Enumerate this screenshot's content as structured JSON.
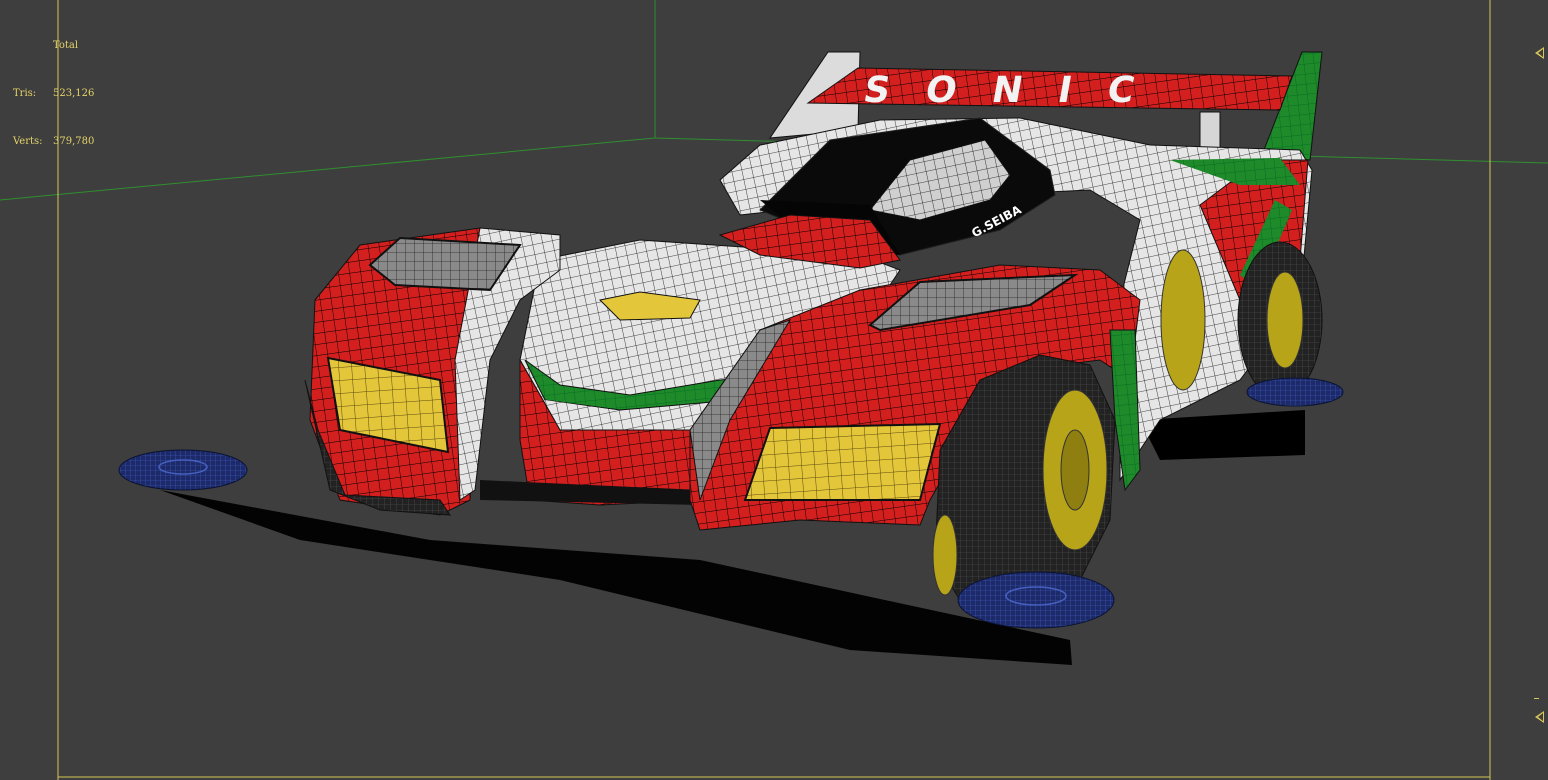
{
  "viewport": {
    "stats": {
      "title": "Total",
      "tris_label": "Tris:",
      "tris_value": "523,126",
      "verts_label": "Verts:",
      "verts_value": "379,780"
    },
    "model": {
      "wing_text": "SONIC",
      "wing_subtext": "",
      "cockpit_text": "G.SEIBA"
    },
    "colors": {
      "background": "#3e3e3e",
      "safe_frame": "#d6c658",
      "grid_line": "#2f8f2f",
      "body_red": "#d41f1f",
      "body_white": "#e8e8e8",
      "body_green": "#1e8a2a",
      "headlight_yellow": "#e4c63a",
      "wheel_yellow": "#b7a419",
      "roller_blue": "#1d2a6a",
      "stats_text": "#e5d36a"
    }
  }
}
